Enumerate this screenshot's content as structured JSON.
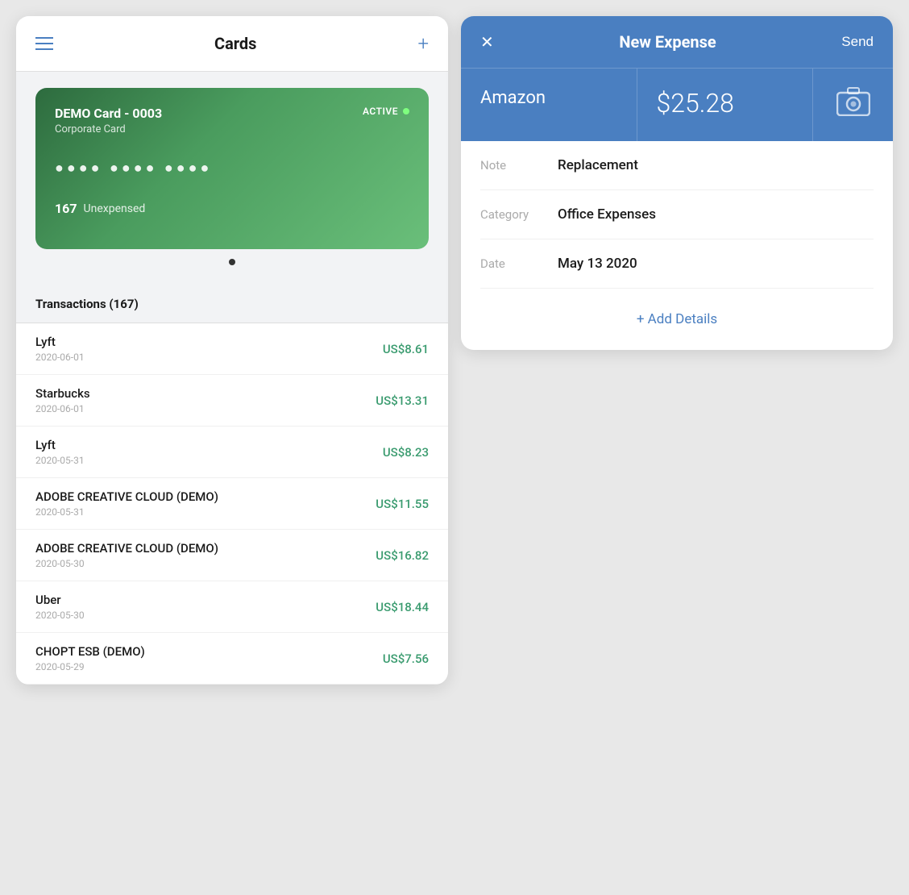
{
  "left": {
    "title": "Cards",
    "add_label": "+",
    "card": {
      "name": "DEMO Card - 0003",
      "type": "Corporate Card",
      "status": "ACTIVE",
      "dots": "●●●● ●●●● ●●●●",
      "unexpensed_count": "167",
      "unexpensed_label": "Unexpensed"
    },
    "transactions_title": "Transactions (167)",
    "transactions": [
      {
        "merchant": "Lyft",
        "date": "2020-06-01",
        "amount": "US$8.61"
      },
      {
        "merchant": "Starbucks",
        "date": "2020-06-01",
        "amount": "US$13.31"
      },
      {
        "merchant": "Lyft",
        "date": "2020-05-31",
        "amount": "US$8.23"
      },
      {
        "merchant": "ADOBE CREATIVE CLOUD (DEMO)",
        "date": "2020-05-31",
        "amount": "US$11.55"
      },
      {
        "merchant": "ADOBE CREATIVE CLOUD (DEMO)",
        "date": "2020-05-30",
        "amount": "US$16.82"
      },
      {
        "merchant": "Uber",
        "date": "2020-05-30",
        "amount": "US$18.44"
      },
      {
        "merchant": "CHOPT ESB (DEMO)",
        "date": "2020-05-29",
        "amount": "US$7.56"
      }
    ]
  },
  "right": {
    "title": "New Expense",
    "close_label": "✕",
    "send_label": "Send",
    "merchant": "Amazon",
    "amount": "$25.28",
    "note_label": "Note",
    "note_value": "Replacement",
    "category_label": "Category",
    "category_value": "Office Expenses",
    "date_label": "Date",
    "date_value": "May 13 2020",
    "add_details_label": "+ Add Details"
  }
}
